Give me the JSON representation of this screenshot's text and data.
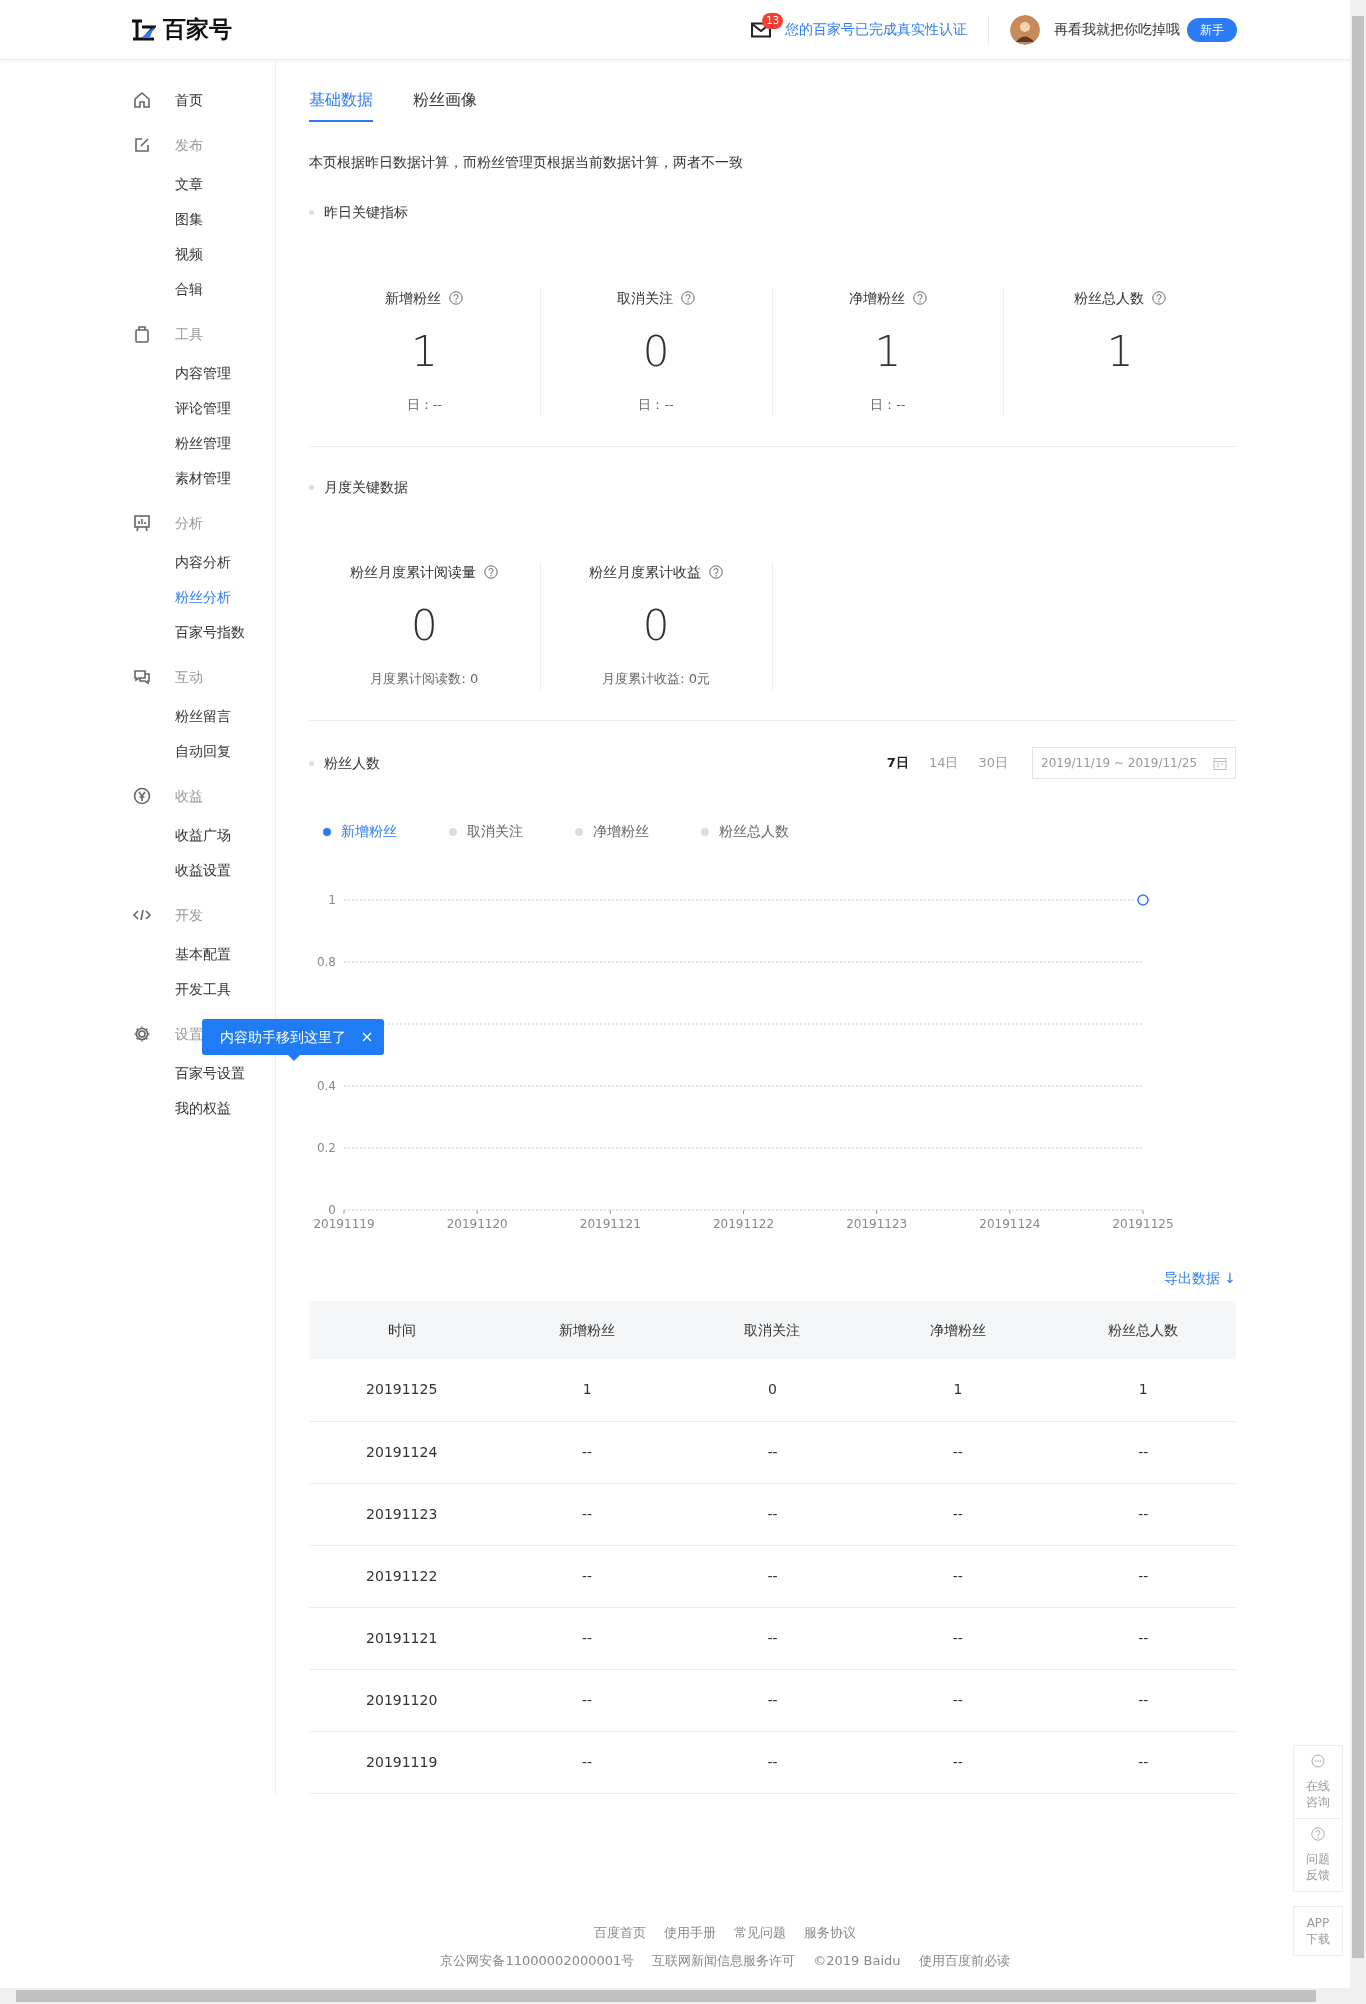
{
  "header": {
    "logo": "百家号",
    "mail_badge": "13",
    "notice": "您的百家号已完成真实性认证",
    "user_name": "再看我就把你吃掉哦",
    "user_badge": "新手"
  },
  "sidebar": {
    "items": [
      {
        "kind": "link",
        "label": "首页",
        "selected": false
      },
      {
        "kind": "group",
        "label": "发布",
        "children": [
          {
            "label": "文章",
            "selected": false
          },
          {
            "label": "图集",
            "selected": false
          },
          {
            "label": "视频",
            "selected": false
          },
          {
            "label": "合辑",
            "selected": false
          }
        ]
      },
      {
        "kind": "group",
        "label": "工具",
        "children": [
          {
            "label": "内容管理",
            "selected": false
          },
          {
            "label": "评论管理",
            "selected": false
          },
          {
            "label": "粉丝管理",
            "selected": false
          },
          {
            "label": "素材管理",
            "selected": false
          }
        ]
      },
      {
        "kind": "group",
        "label": "分析",
        "children": [
          {
            "label": "内容分析",
            "selected": false
          },
          {
            "label": "粉丝分析",
            "selected": true
          },
          {
            "label": "百家号指数",
            "selected": false
          }
        ]
      },
      {
        "kind": "group",
        "label": "互动",
        "children": [
          {
            "label": "粉丝留言",
            "selected": false
          },
          {
            "label": "自动回复",
            "selected": false
          }
        ]
      },
      {
        "kind": "group",
        "label": "收益",
        "children": [
          {
            "label": "收益广场",
            "selected": false
          },
          {
            "label": "收益设置",
            "selected": false
          }
        ]
      },
      {
        "kind": "group",
        "label": "开发",
        "children": [
          {
            "label": "基本配置",
            "selected": false
          },
          {
            "label": "开发工具",
            "selected": false
          }
        ]
      },
      {
        "kind": "group",
        "label": "设置",
        "children": [
          {
            "label": "百家号设置",
            "selected": false
          },
          {
            "label": "我的权益",
            "selected": false
          }
        ]
      }
    ]
  },
  "tooltip": {
    "text": "内容助手移到这里了"
  },
  "tabs": [
    {
      "label": "基础数据",
      "selected": true
    },
    {
      "label": "粉丝画像",
      "selected": false
    }
  ],
  "notice": "本页根据昨日数据计算，而粉丝管理页根据当前数据计算，两者不一致",
  "yesterday": {
    "title": "昨日关键指标",
    "metrics": [
      {
        "label": "新增粉丝",
        "value": "1",
        "sub": "日：--"
      },
      {
        "label": "取消关注",
        "value": "0",
        "sub": "日：--"
      },
      {
        "label": "净增粉丝",
        "value": "1",
        "sub": "日：--"
      },
      {
        "label": "粉丝总人数",
        "value": "1"
      }
    ]
  },
  "monthly": {
    "title": "月度关键数据",
    "metrics": [
      {
        "label": "粉丝月度累计阅读量",
        "value": "0",
        "sub": "月度累计阅读数: 0"
      },
      {
        "label": "粉丝月度累计收益",
        "value": "0",
        "sub": "月度累计收益: 0元"
      }
    ]
  },
  "fans_chart": {
    "title": "粉丝人数",
    "ranges": [
      {
        "label": "7日",
        "selected": true
      },
      {
        "label": "14日",
        "selected": false
      },
      {
        "label": "30日",
        "selected": false
      }
    ],
    "date_range": "2019/11/19 ~ 2019/11/25",
    "legend": [
      {
        "selected": true
      },
      {
        "label": "取消关注",
        "selected": false
      },
      {
        "label": "净增粉丝",
        "selected": false
      },
      {
        "label": "粉丝总人数",
        "selected": false
      }
    ],
    "chart_data": {
      "type": "line",
      "categories": [
        "20191119",
        "20191120",
        "20191121",
        "20191122",
        "20191123",
        "20191124",
        "20191125"
      ],
      "series": [
        {
          "name": "新增粉丝",
          "color": "#2b7cf6",
          "marker": "circle",
          "values": [
            null,
            null,
            null,
            null,
            null,
            null,
            1
          ]
        }
      ],
      "ylim": [
        0,
        1
      ],
      "yticks": [
        0,
        0.2,
        0.4,
        0.8,
        1
      ],
      "grid": true
    }
  },
  "export_link": "导出数据 ↓",
  "table": {
    "columns": [
      "时间",
      "新增粉丝",
      "取消关注",
      "净增粉丝",
      "粉丝总人数"
    ],
    "rows": [
      [
        "20191125",
        "1",
        "0",
        "1",
        "1"
      ],
      [
        "20191124",
        "--",
        "--",
        "--",
        "--"
      ],
      [
        "20191123",
        "--",
        "--",
        "--",
        "--"
      ],
      [
        "20191122",
        "--",
        "--",
        "--",
        "--"
      ],
      [
        "20191121",
        "--",
        "--",
        "--",
        "--"
      ],
      [
        "20191120",
        "--",
        "--",
        "--",
        "--"
      ],
      [
        "20191119",
        "--",
        "--",
        "--",
        "--"
      ]
    ]
  },
  "footer": {
    "links": [
      "百度首页",
      "使用手册",
      "常见问题",
      "服务协议"
    ],
    "legal": [
      "京公网安备11000002000001号",
      "互联网新闻信息服务许可",
      "©2019 Baidu",
      "使用百度前必读"
    ]
  },
  "side_buttons": [
    {
      "kind": "chat",
      "lines": [
        "在线",
        "咨询"
      ]
    },
    {
      "kind": "help",
      "lines": [
        "问题",
        "反馈"
      ]
    },
    {
      "kind": "plain",
      "lines": [
        "APP",
        "下载"
      ]
    }
  ]
}
